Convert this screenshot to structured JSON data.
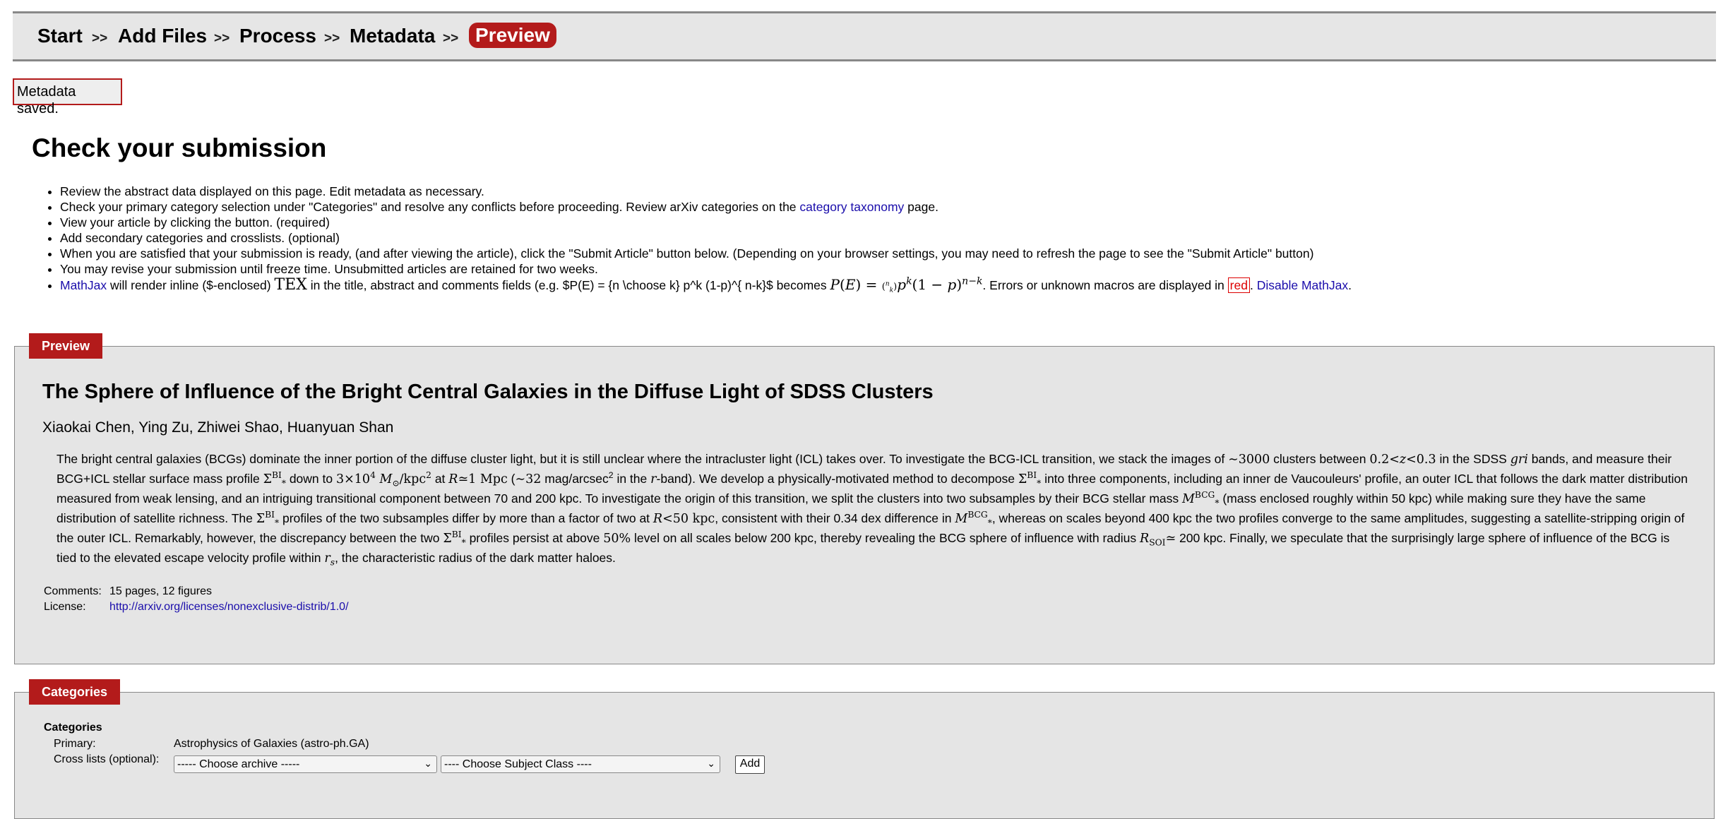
{
  "breadcrumb": {
    "steps": [
      "Start",
      "Add Files",
      "Process",
      "Metadata"
    ],
    "separator": ">>",
    "active": "Preview"
  },
  "flash": "Metadata saved.",
  "page_title": "Check your submission",
  "instructions": {
    "items": [
      "Review the abstract data displayed on this page. Edit metadata as necessary.",
      "View your article by clicking the button. (required)",
      "Add secondary categories and crosslists. (optional)",
      "When you are satisfied that your submission is ready, (and after viewing the article), click the \"Submit Article\" button below. (Depending on your browser settings, you may need to refresh the page to see the \"Submit Article\" button)",
      "You may revise your submission until freeze time. Unsubmitted articles are retained for two weeks."
    ],
    "category_item_pre": "Check your primary category selection under \"Categories\" and resolve any conflicts before proceeding. Review arXiv categories on the",
    "category_link": "category taxonomy",
    "category_item_post": "page.",
    "mathjax_link": "MathJax",
    "mathjax_text1": "will render inline ($-enclosed)",
    "mathjax_tex": "TEX",
    "mathjax_text2": "in the title, abstract and comments fields (e.g. $P(E) = {n \\choose k} p^k (1-p)^{ n-k}$ becomes",
    "mathjax_text3": ". Errors or unknown macros are displayed in",
    "red_word": "red",
    "disable_link": "Disable MathJax",
    "end_period": "."
  },
  "preview": {
    "legend": "Preview",
    "title": "The Sphere of Influence of the Bright Central Galaxies in the Diffuse Light of SDSS Clusters",
    "authors": "Xiaokai Chen, Ying Zu, Zhiwei Shao, Huanyuan Shan",
    "abstract": {
      "p1": "The bright central galaxies (BCGs) dominate the inner portion of the diffuse cluster light, but it is still unclear where the intracluster light (ICL) takes over. To investigate the BCG-ICL transition, we stack the images of",
      "p2": "clusters between",
      "p3": "in the SDSS",
      "p4": "bands, and measure their BCG+ICL stellar surface mass profile",
      "p5": "down to",
      "p6": "at",
      "p7": "mag/arcsec",
      "p8": "in the",
      "p9": "-band). We develop a physically-motivated method to decompose",
      "p10": "into three components, including an inner de Vaucouleurs' profile, an outer ICL that follows the dark matter distribution measured from weak lensing, and an intriguing transitional component between 70 and 200 kpc. To investigate the origin of this transition, we split the clusters into two subsamples by their BCG stellar mass",
      "p11": "(mass enclosed roughly within 50 kpc) while making sure they have the same distribution of satellite richness. The",
      "p12": "profiles of the two subsamples differ by more than a factor of two at",
      "p13": ", consistent with their 0.34 dex difference in",
      "p14": ", whereas on scales beyond 400 kpc the two profiles converge to the same amplitudes, suggesting a satellite-stripping origin of the outer ICL. Remarkably, however, the discrepancy between the two",
      "p15": "profiles persist at above",
      "p16": "level on all scales below 200 kpc, thereby revealing the BCG sphere of influence with radius",
      "p17": "200 kpc. Finally, we speculate that the surprisingly large sphere of influence of the BCG is tied to the elevated escape velocity profile within",
      "p18": ", the characteristic radius of the dark matter haloes."
    },
    "comments_label": "Comments:",
    "comments": "15 pages, 12 figures",
    "license_label": "License:",
    "license": "http://arxiv.org/licenses/nonexclusive-distrib/1.0/"
  },
  "categories": {
    "legend": "Categories",
    "heading": "Categories",
    "primary_label": "Primary:",
    "primary": "Astrophysics of Galaxies (astro-ph.GA)",
    "crosslist_label": "Cross lists (optional):",
    "archive_select": "----- Choose archive -----",
    "subject_select": "---- Choose Subject Class ----",
    "add_button": "Add"
  },
  "colors": {
    "accent": "#b31b1b",
    "panel": "#e5e5e5",
    "link": "#1a0dab"
  }
}
